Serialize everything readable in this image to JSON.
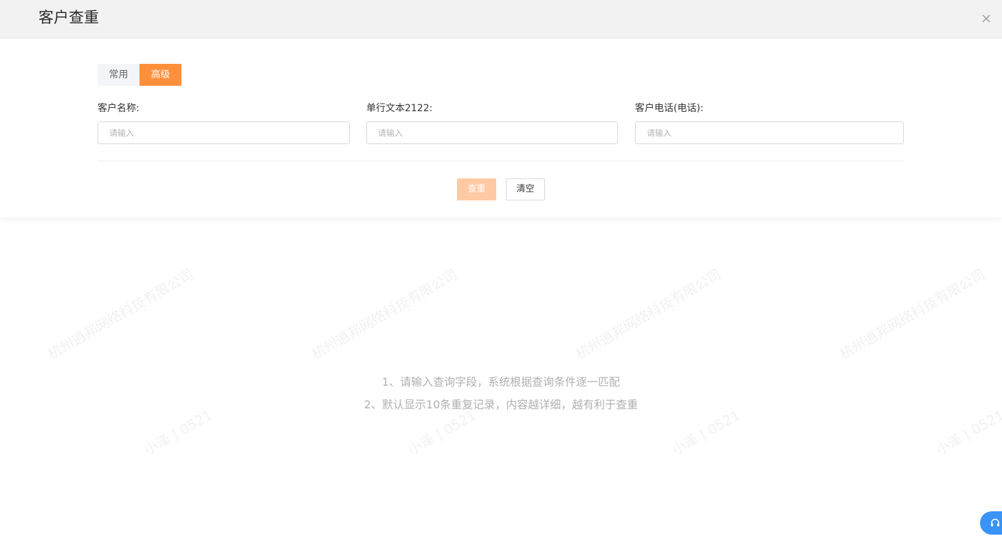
{
  "dialog": {
    "title": "客户查重"
  },
  "tabs": [
    {
      "label": "常用",
      "active": false
    },
    {
      "label": "高级",
      "active": true
    }
  ],
  "fields": [
    {
      "label": "客户名称:",
      "placeholder": "请输入",
      "value": ""
    },
    {
      "label": "单行文本2122:",
      "placeholder": "请输入",
      "value": ""
    },
    {
      "label": "客户电话(电话):",
      "placeholder": "请输入",
      "value": ""
    }
  ],
  "buttons": {
    "query_label": "查重",
    "clear_label": "清空"
  },
  "hints": {
    "line1": "1、请输入查询字段，系统根据查询条件逐一匹配",
    "line2": "2、默认显示10条重复记录，内容越详细，越有利于查重"
  },
  "watermark": {
    "company": "杭州逍邦网络科技有限公司",
    "user": "小泽 | 0521"
  },
  "icons": {
    "close": "close-icon",
    "service": "headset-icon"
  },
  "colors": {
    "accent": "#ff8f3b",
    "accent_disabled": "#ffc9a3",
    "service": "#3a93f7"
  }
}
